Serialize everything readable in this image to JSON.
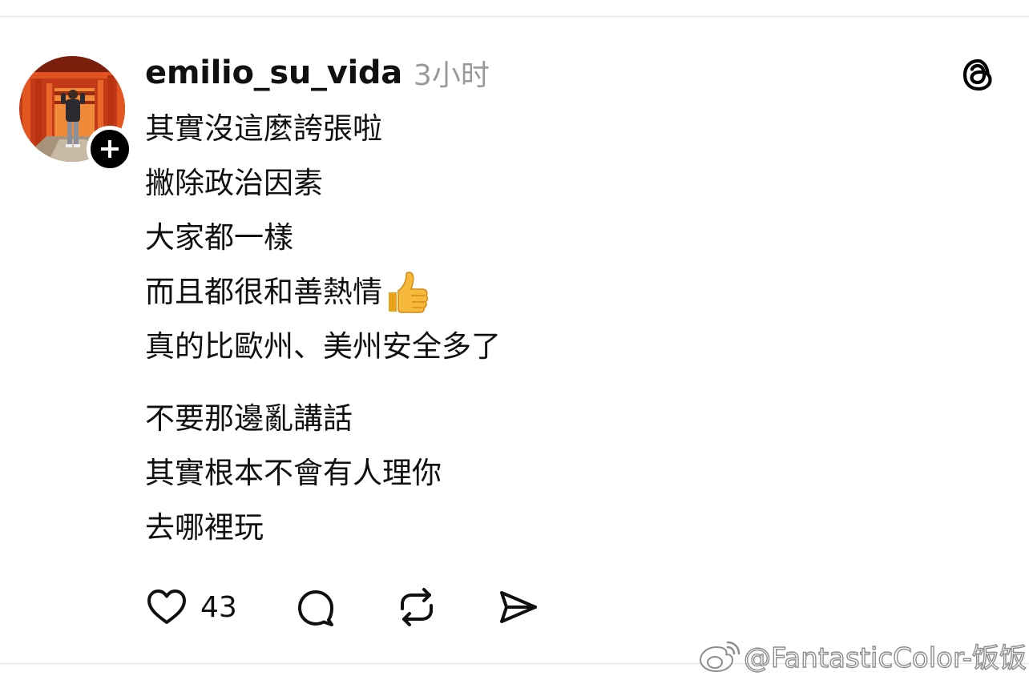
{
  "post": {
    "username": "emilio_su_vida",
    "time": "3小时",
    "lines_part1": [
      "其實沒這麼誇張啦",
      "撇除政治因素",
      "大家都一樣",
      "而且都很和善熱情",
      "真的比歐州、美州安全多了"
    ],
    "lines_part2": [
      "不要那邊亂講話",
      "其實根本不會有人理你",
      "去哪裡玩"
    ],
    "emoji": "thumbs-up"
  },
  "actions": {
    "like_count": "43",
    "like_icon": "heart-icon",
    "comment_icon": "comment-icon",
    "repost_icon": "repost-icon",
    "share_icon": "send-icon"
  },
  "watermark": {
    "text": "@FantasticColor-饭饭"
  },
  "colors": {
    "text": "#101010",
    "secondary": "#9a9a9a",
    "divider": "#e2e2e2"
  }
}
